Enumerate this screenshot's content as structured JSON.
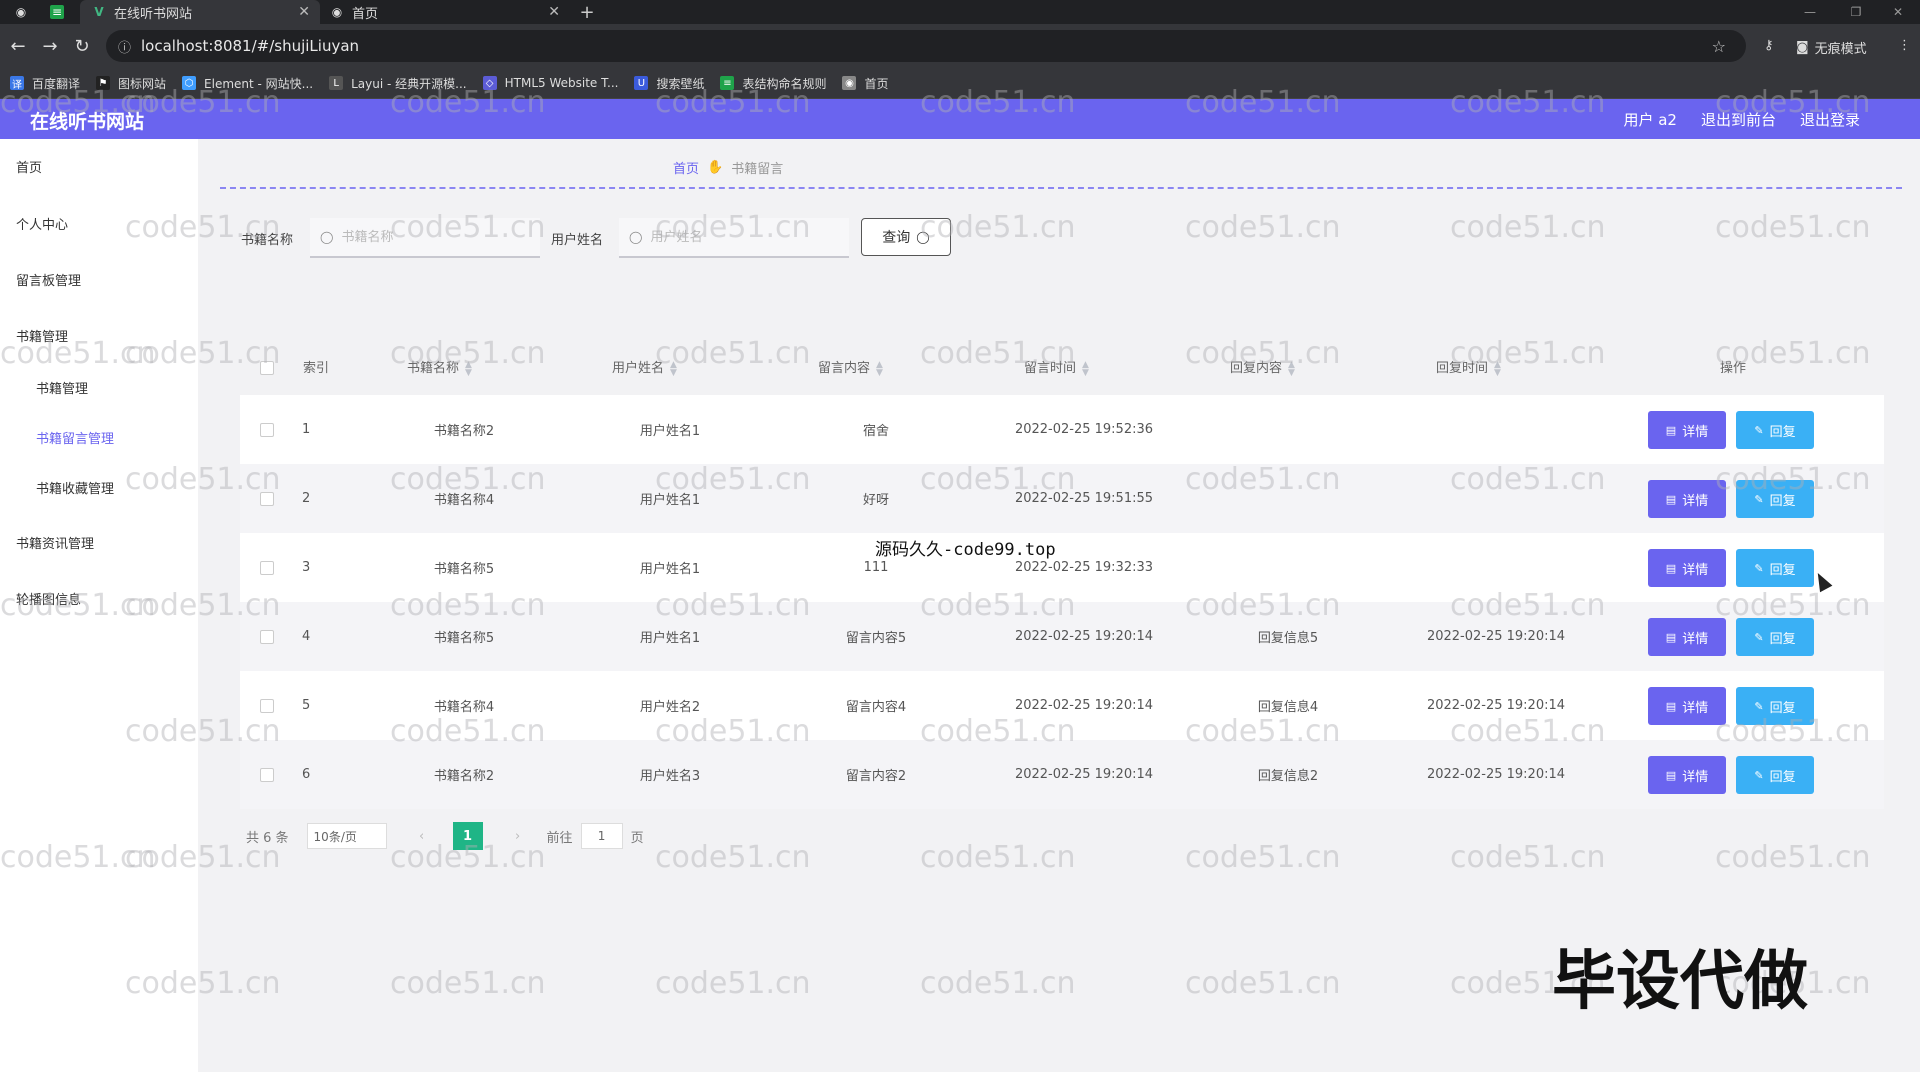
{
  "browser": {
    "tabs": [
      {
        "title": "在线听书网站",
        "active": true
      },
      {
        "title": "首页",
        "active": false
      }
    ],
    "url": "localhost:8081/#/shujiLiuyan",
    "profile_label": "无痕模式",
    "bookmarks": [
      {
        "label": "百度翻译",
        "color": "#3b78e7"
      },
      {
        "label": "图标网站",
        "color": "#222222"
      },
      {
        "label": "Element - 网站快...",
        "color": "#409eff"
      },
      {
        "label": "Layui - 经典开源模...",
        "color": "#555555"
      },
      {
        "label": "HTML5 Website T...",
        "color": "#5c5cd6"
      },
      {
        "label": "搜索壁纸",
        "color": "#3b5bdb"
      },
      {
        "label": "表结构命名规则",
        "color": "#1fa34a"
      },
      {
        "label": "首页",
        "color": "#888888"
      }
    ]
  },
  "app": {
    "title": "在线听书网站",
    "user_label": "用户 a2",
    "back_to_front": "退出到前台",
    "logout": "退出登录",
    "accent_color": "#6a64ef"
  },
  "sidebar": {
    "items": [
      {
        "label": "首页",
        "level": 0
      },
      {
        "label": "个人中心",
        "level": 0
      },
      {
        "label": "留言板管理",
        "level": 0
      },
      {
        "label": "书籍管理",
        "level": 0
      },
      {
        "label": "书籍管理",
        "level": 1
      },
      {
        "label": "书籍留言管理",
        "level": 1,
        "active": true
      },
      {
        "label": "书籍收藏管理",
        "level": 1
      },
      {
        "label": "书籍资讯管理",
        "level": 0
      },
      {
        "label": "轮播图信息",
        "level": 0
      }
    ]
  },
  "breadcrumb": {
    "home": "首页",
    "current": "书籍留言"
  },
  "search": {
    "book_label": "书籍名称",
    "book_placeholder": "书籍名称",
    "user_label": "用户姓名",
    "user_placeholder": "用户姓名",
    "query_button": "查询"
  },
  "table": {
    "headers": {
      "index": "索引",
      "book": "书籍名称",
      "user": "用户姓名",
      "content": "留言内容",
      "time": "留言时间",
      "reply": "回复内容",
      "reply_time": "回复时间",
      "ops": "操作"
    },
    "detail_label": "详情",
    "reply_label": "回复",
    "rows": [
      {
        "index": "1",
        "book": "书籍名称2",
        "user": "用户姓名1",
        "content": "宿舍",
        "time": "2022-02-25 19:52:36",
        "reply": "",
        "reply_time": ""
      },
      {
        "index": "2",
        "book": "书籍名称4",
        "user": "用户姓名1",
        "content": "好呀",
        "time": "2022-02-25 19:51:55",
        "reply": "",
        "reply_time": ""
      },
      {
        "index": "3",
        "book": "书籍名称5",
        "user": "用户姓名1",
        "content": "111",
        "time": "2022-02-25 19:32:33",
        "reply": "",
        "reply_time": ""
      },
      {
        "index": "4",
        "book": "书籍名称5",
        "user": "用户姓名1",
        "content": "留言内容5",
        "time": "2022-02-25 19:20:14",
        "reply": "回复信息5",
        "reply_time": "2022-02-25 19:20:14"
      },
      {
        "index": "5",
        "book": "书籍名称4",
        "user": "用户姓名2",
        "content": "留言内容4",
        "time": "2022-02-25 19:20:14",
        "reply": "回复信息4",
        "reply_time": "2022-02-25 19:20:14"
      },
      {
        "index": "6",
        "book": "书籍名称2",
        "user": "用户姓名3",
        "content": "留言内容2",
        "time": "2022-02-25 19:20:14",
        "reply": "回复信息2",
        "reply_time": "2022-02-25 19:20:14"
      }
    ]
  },
  "pagination": {
    "total": "共 6 条",
    "page_size": "10条/页",
    "current_page": "1",
    "goto_prefix": "前往",
    "goto_value": "1",
    "goto_suffix": "页"
  },
  "overlays": {
    "watermark": "code51.cn",
    "code99": "源码久久-code99.top",
    "bishe": "毕设代做"
  }
}
